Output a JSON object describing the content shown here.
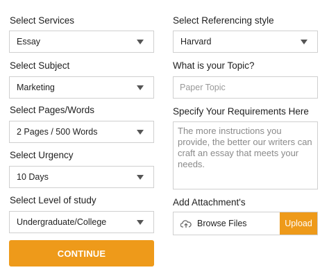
{
  "left": {
    "services": {
      "label": "Select Services",
      "value": "Essay"
    },
    "subject": {
      "label": "Select Subject",
      "value": "Marketing"
    },
    "pages": {
      "label": "Select Pages/Words",
      "value": "2 Pages / 500 Words"
    },
    "urgency": {
      "label": "Select Urgency",
      "value": "10 Days"
    },
    "level": {
      "label": "Select Level of study",
      "value": "Undergraduate/College"
    },
    "continue_label": "CONTINUE"
  },
  "right": {
    "referencing": {
      "label": "Select Referencing style",
      "value": "Harvard"
    },
    "topic": {
      "label": "What is your Topic?",
      "placeholder": "Paper Topic"
    },
    "requirements": {
      "label": "Specify Your Requirements Here",
      "placeholder": "The more instructions you provide, the better our writers can craft an essay that meets your needs."
    },
    "attachment": {
      "label": "Add Attachment's",
      "browse_label": "Browse Files",
      "upload_label": "Upload"
    }
  },
  "colors": {
    "accent": "#ee9a1a",
    "border": "#cfcfcf"
  },
  "icons": {
    "dropdown": "chevron-down-icon",
    "upload": "cloud-upload-icon"
  }
}
